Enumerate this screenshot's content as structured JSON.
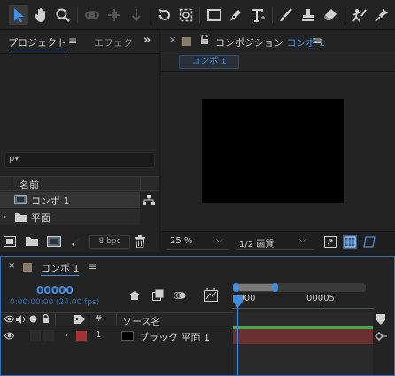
{
  "toolbar": {
    "tools": [
      "selection-tool",
      "hand-tool",
      "zoom-tool",
      "orbit-camera-tool",
      "pan-camera-tool",
      "dolly-camera-tool",
      "rotation-tool",
      "pan-behind-tool",
      "rectangle-tool",
      "pen-tool",
      "type-tool",
      "brush-tool",
      "clone-stamp-tool",
      "eraser-tool",
      "roto-brush-tool",
      "puppet-tool"
    ]
  },
  "project_panel": {
    "tab_active": "プロジェクト",
    "tab_inactive": "エフェク",
    "search_placeholder": "ρ▾",
    "column_name": "名前",
    "items": [
      {
        "label": "コンポ 1",
        "type": "composition"
      },
      {
        "label": "平面",
        "type": "folder"
      }
    ],
    "bpc_label": "8 bpc"
  },
  "viewer_panel": {
    "tab_prefix": "コンポジション",
    "tab_comp_name": "コンポ 1",
    "comp_button": "コンポ 1",
    "zoom": "25 %",
    "resolution": "1/2 画質",
    "colors": {
      "canvas": "#000000"
    }
  },
  "timeline_panel": {
    "tab_label": "コンポ 1",
    "timecode": "00000",
    "timecode_sub": "0:00:00:00 (24.00 fps)",
    "ruler_start": "0000",
    "ruler_mark": "00005",
    "col_hash": "#",
    "col_source": "ソース名",
    "layers": [
      {
        "number": "1",
        "name": "ブラック 平面 1",
        "label_color": "#a83232"
      }
    ]
  }
}
